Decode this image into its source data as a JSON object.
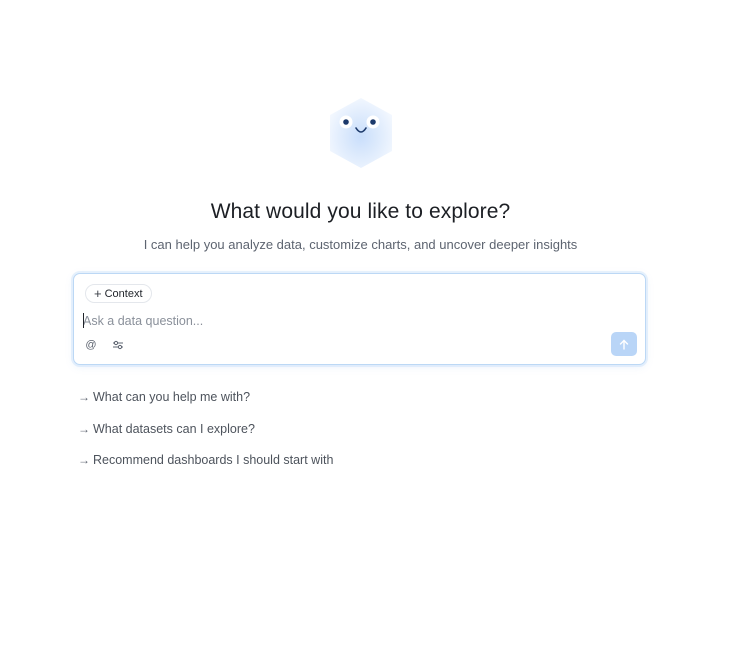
{
  "mascot": {
    "icon": "hexagon-smiley-icon",
    "color": "#dbeafe",
    "eye_color": "#1d3a6b"
  },
  "hero": {
    "title": "What would you like to explore?",
    "subtitle": "I can help you analyze data, customize charts, and uncover deeper insights"
  },
  "composer": {
    "context_label": "Context",
    "context_icon": "plus-icon",
    "placeholder": "Ask a data question...",
    "value": "",
    "tools": [
      {
        "icon": "at-icon",
        "glyph": "@"
      },
      {
        "icon": "sliders-icon"
      }
    ],
    "send_icon": "arrow-up-icon",
    "accent": "#b9d5f7",
    "border": "#bcd8f5"
  },
  "suggestions": [
    {
      "arrow": "→",
      "label": "What can you help me with?"
    },
    {
      "arrow": "→",
      "label": "What datasets can I explore?"
    },
    {
      "arrow": "→",
      "label": "Recommend dashboards I should start with"
    }
  ]
}
